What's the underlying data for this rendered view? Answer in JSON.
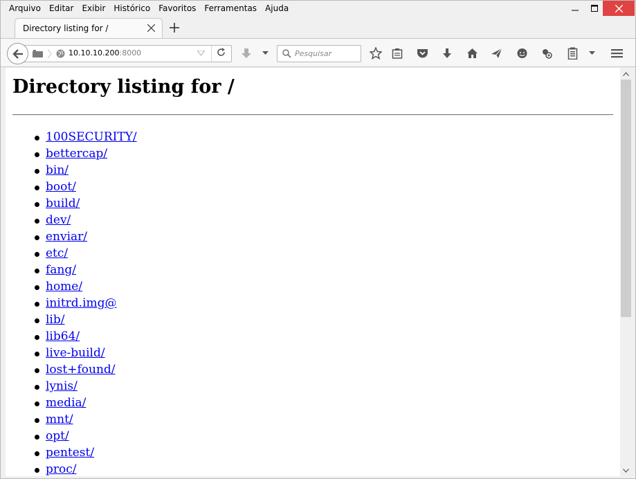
{
  "menubar": {
    "items": [
      "Arquivo",
      "Editar",
      "Exibir",
      "Histórico",
      "Favoritos",
      "Ferramentas",
      "Ajuda"
    ]
  },
  "tab": {
    "title": "Directory listing for /"
  },
  "navbar": {
    "url_host": "10.10.10.200",
    "url_port": ":8000",
    "search_placeholder": "Pesquisar"
  },
  "page": {
    "heading": "Directory listing for /",
    "entries": [
      "100SECURITY/",
      "bettercap/",
      "bin/",
      "boot/",
      "build/",
      "dev/",
      "enviar/",
      "etc/",
      "fang/",
      "home/",
      "initrd.img@",
      "lib/",
      "lib64/",
      "live-build/",
      "lost+found/",
      "lynis/",
      "media/",
      "mnt/",
      "opt/",
      "pentest/",
      "proc/"
    ]
  },
  "colors": {
    "link": "#0000ee",
    "close_button": "#e04343"
  }
}
